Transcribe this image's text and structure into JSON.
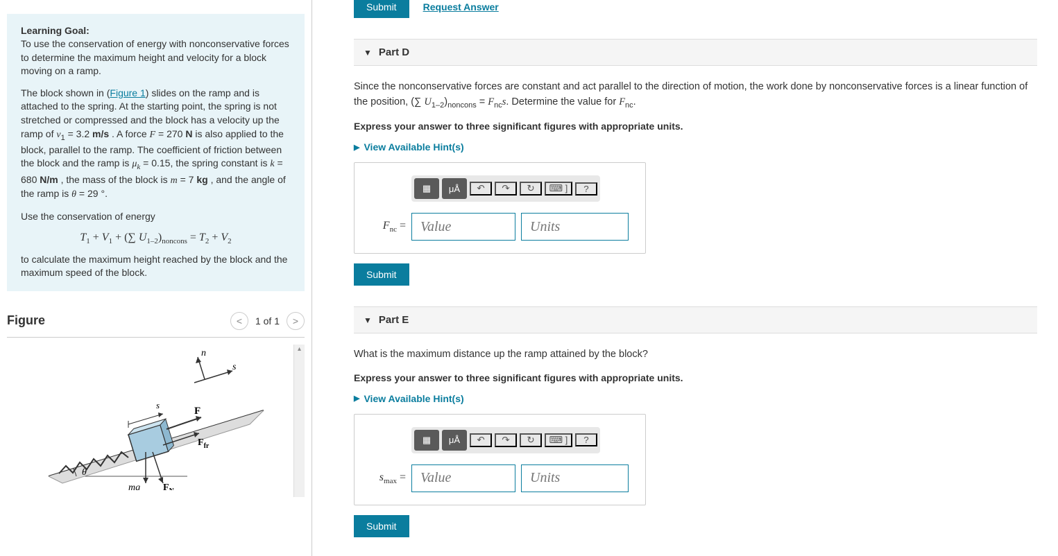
{
  "leftPanel": {
    "learningGoal": {
      "title": "Learning Goal:",
      "intro": "To use the conservation of energy with nonconservative forces to determine the maximum height and velocity for a block moving on a ramp.",
      "figureLinkText": "Figure 1",
      "v1": "3.2",
      "v1_units": "m/s",
      "F_val": "270",
      "F_units": "N",
      "mu_k": "0.15",
      "k_val": "680",
      "k_units": "N/m",
      "m_val": "7",
      "m_units": "kg",
      "theta": "29",
      "useConservation": "Use the conservation of energy",
      "equation": "T₁ + V₁ + (∑ U₁₋₂)noncons = T₂ + V₂",
      "closing": "to calculate the maximum height reached by the block and the maximum speed of the block."
    },
    "figure": {
      "title": "Figure",
      "count": "1 of 1"
    }
  },
  "topBar": {
    "submit": "Submit",
    "requestAnswer": "Request Answer"
  },
  "partD": {
    "title": "Part D",
    "instruction": "Express your answer to three significant figures with appropriate units.",
    "hintsLabel": "View Available Hint(s)",
    "valuePlaceholder": "Value",
    "unitsPlaceholder": "Units",
    "submit": "Submit",
    "varLabel": "Fnc ="
  },
  "partE": {
    "title": "Part E",
    "question": "What is the maximum distance up the ramp attained by the block?",
    "instruction": "Express your answer to three significant figures with appropriate units.",
    "hintsLabel": "View Available Hint(s)",
    "valuePlaceholder": "Value",
    "unitsPlaceholder": "Units",
    "submit": "Submit",
    "varLabel": "smax ="
  },
  "toolbar": {
    "templates": "▦",
    "special": "μÅ",
    "undo": "↶",
    "redo": "↷",
    "reset": "↻",
    "keyboard": "⌨ ]",
    "help": "?"
  }
}
